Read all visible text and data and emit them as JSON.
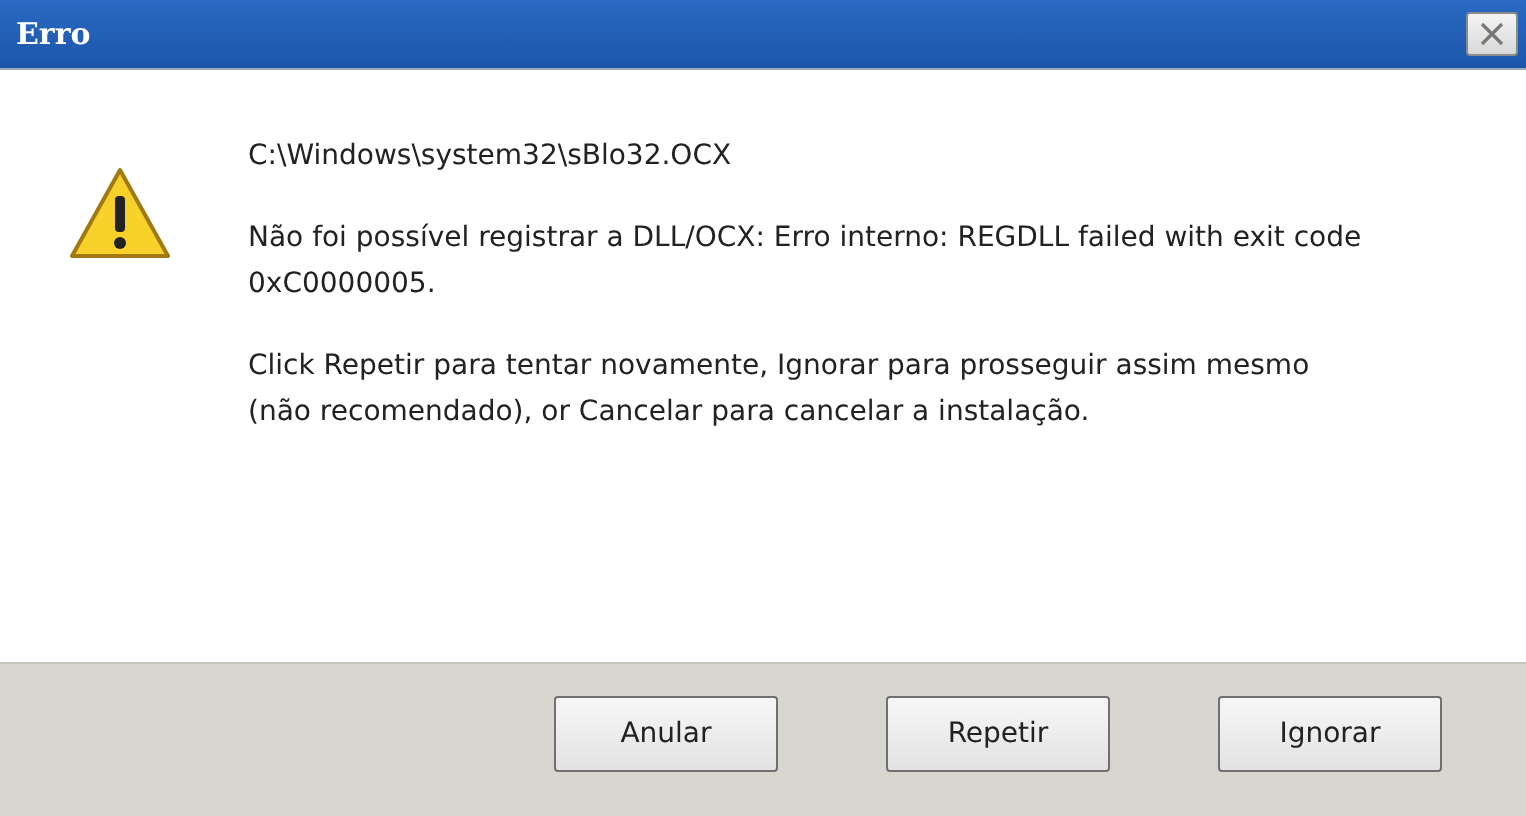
{
  "window": {
    "title": "Erro"
  },
  "message": {
    "path": "C:\\Windows\\system32\\sBlo32.OCX",
    "error": "Não foi possível registrar a DLL/OCX: Erro interno: REGDLL failed with exit code 0xC0000005.",
    "hint": "Click Repetir para tentar novamente, Ignorar para prosseguir assim mesmo (não recomendado), or Cancelar para cancelar a instalação."
  },
  "buttons": [
    {
      "label": "Anular"
    },
    {
      "label": "Repetir"
    },
    {
      "label": "Ignorar"
    }
  ]
}
